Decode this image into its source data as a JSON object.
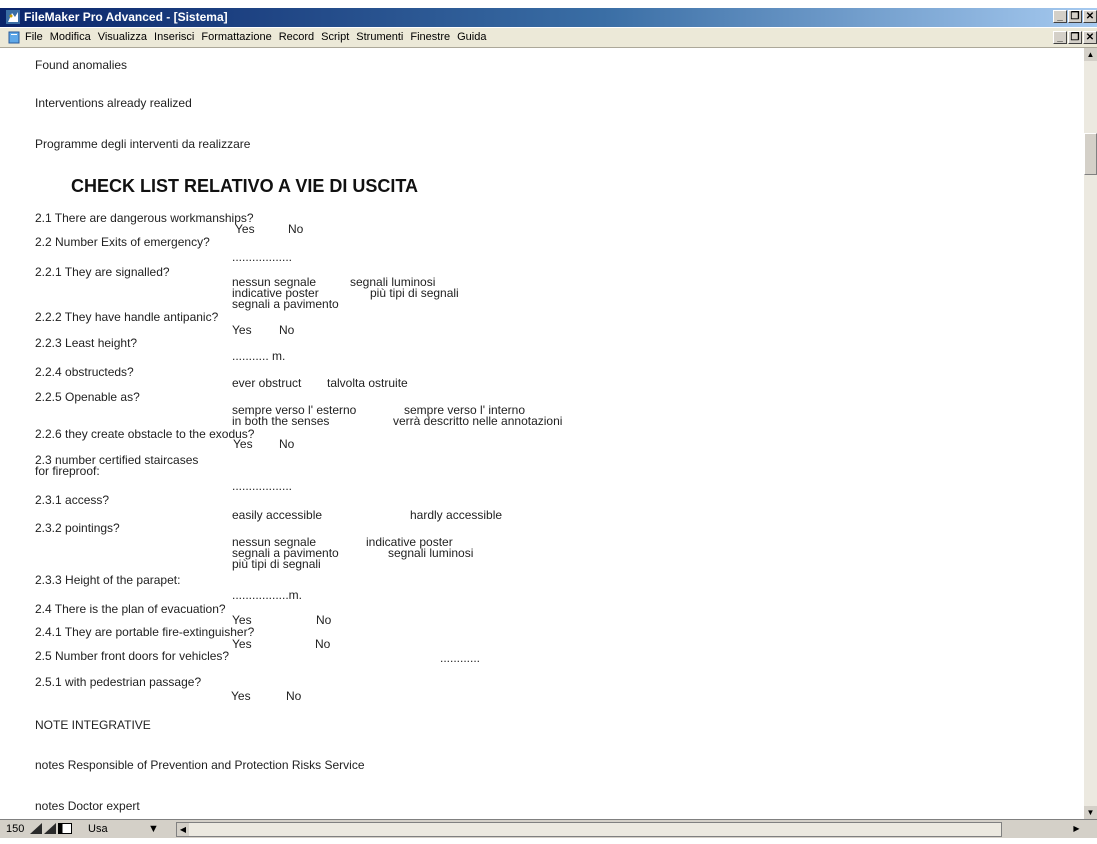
{
  "window": {
    "title": "FileMaker Pro Advanced - [Sistema]",
    "controls": [
      "_",
      "8",
      "×"
    ]
  },
  "menubar": {
    "items": [
      "File",
      "Modifica",
      "Visualizza",
      "Inserisci",
      "Formattazione",
      "Record",
      "Script",
      "Strumenti",
      "Finestre",
      "Guida"
    ]
  },
  "form": {
    "found_anomalies": "Found anomalies",
    "interventions_realized": "Interventions already realized",
    "programme": "Programme degli interventi da realizzare",
    "heading": "CHECK LIST RELATIVO A VIE DI USCITA",
    "q2_1": "2.1 There are dangerous workmanships?",
    "q2_1_yes": "Yes",
    "q2_1_no": "No",
    "q2_2": "2.2 Number Exits of emergency?",
    "q2_2_val": "..................",
    "q2_2_1": "2.2.1 They are signalled?",
    "q2_2_1_opt1": "nessun segnale",
    "q2_2_1_opt2": "segnali luminosi",
    "q2_2_1_opt3": "indicative poster",
    "q2_2_1_opt4": "più tipi di segnali",
    "q2_2_1_opt5": "segnali a pavimento",
    "q2_2_2": "2.2.2 They have handle antipanic?",
    "q2_2_2_yes": "Yes",
    "q2_2_2_no": "No",
    "q2_2_3": "2.2.3 Least height?",
    "q2_2_3_val": "........... m.",
    "q2_2_4": "2.2.4 obstructeds?",
    "q2_2_4_opt1": "ever obstruct",
    "q2_2_4_opt2": "talvolta ostruite",
    "q2_2_5": "2.2.5 Openable as?",
    "q2_2_5_opt1": "sempre verso l' esterno",
    "q2_2_5_opt2": "sempre verso l' interno",
    "q2_2_5_opt3": "in both the senses",
    "q2_2_5_opt4": "verrà descritto nelle annotazioni",
    "q2_2_6": "2.2.6 they create obstacle to the exodus?",
    "q2_2_6_yes": "Yes",
    "q2_2_6_no": "No",
    "q2_3_line1": "2.3 number certified staircases",
    "q2_3_line2": "for fireproof:",
    "q2_3_val": "..................",
    "q2_3_1": "2.3.1 access?",
    "q2_3_1_opt1": "easily accessible",
    "q2_3_1_opt2": "hardly accessible",
    "q2_3_2": "2.3.2 pointings?",
    "q2_3_2_opt1": "nessun segnale",
    "q2_3_2_opt2": "indicative poster",
    "q2_3_2_opt3": "segnali a pavimento",
    "q2_3_2_opt4": "segnali luminosi",
    "q2_3_2_opt5": "più tipi di segnali",
    "q2_3_3": "2.3.3 Height of the parapet:",
    "q2_3_3_val": ".................m.",
    "q2_4": "2.4  There is the plan of evacuation?",
    "q2_4_yes": "Yes",
    "q2_4_no": "No",
    "q2_4_1": "2.4.1 They are portable fire-extinguisher?",
    "q2_4_1_yes": "Yes",
    "q2_4_1_no": "No",
    "q2_5": "2.5 Number front doors for vehicles?",
    "q2_5_val": "............",
    "q2_5_1": "2.5.1 with pedestrian passage?",
    "q2_5_1_yes": "Yes",
    "q2_5_1_no": "No",
    "note_integrative": "NOTE INTEGRATIVE",
    "notes_rspp": "notes Responsible of  Prevention and Protection Risks Service",
    "notes_doctor": "notes Doctor expert"
  },
  "statusbar": {
    "zoom": "150",
    "mode": "Usa"
  },
  "colors": {
    "titlebar_start": "#0a246a",
    "menubar_bg": "#ece9d8",
    "chrome": "#d4d0c8"
  }
}
